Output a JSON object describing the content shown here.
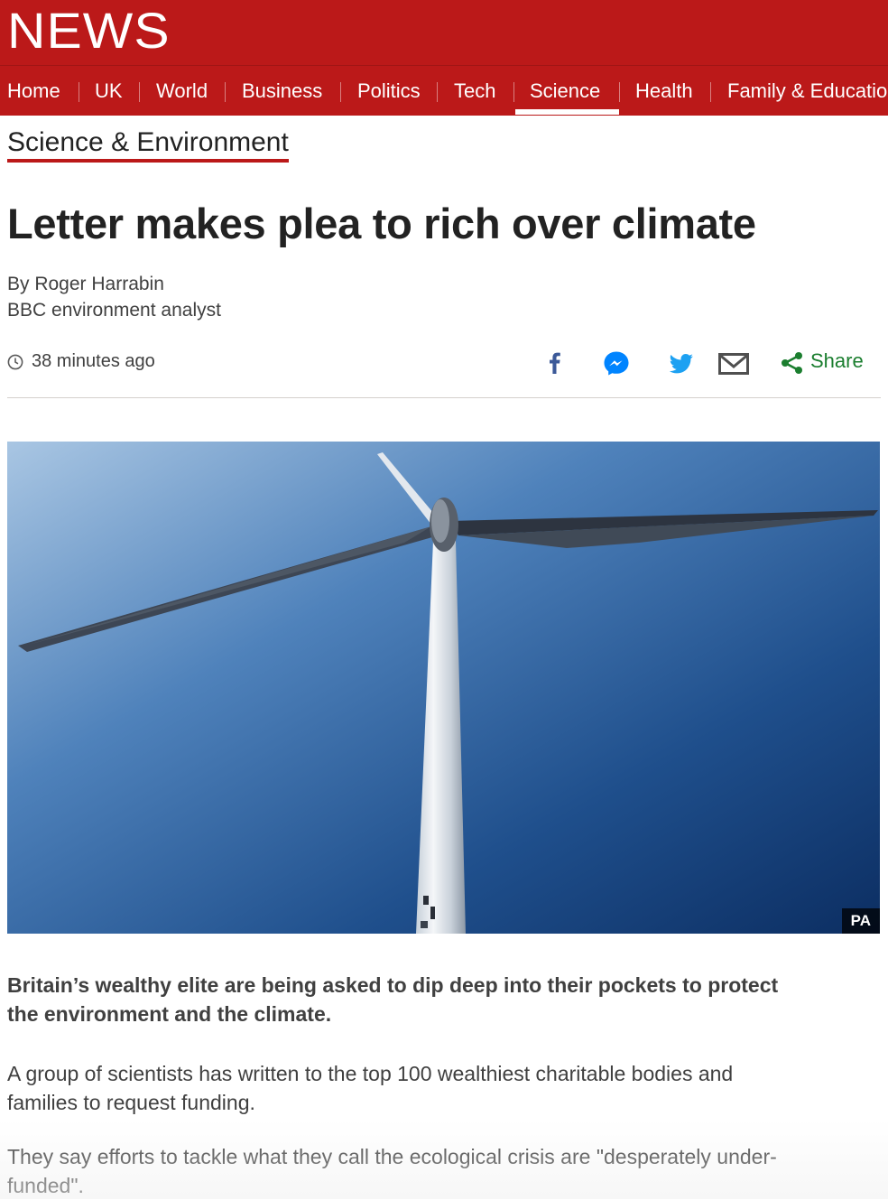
{
  "header": {
    "logo": "NEWS"
  },
  "nav": {
    "items": [
      {
        "label": "Home"
      },
      {
        "label": "UK"
      },
      {
        "label": "World"
      },
      {
        "label": "Business"
      },
      {
        "label": "Politics"
      },
      {
        "label": "Tech"
      },
      {
        "label": "Science",
        "active": true
      },
      {
        "label": "Health"
      },
      {
        "label": "Family & Education"
      }
    ]
  },
  "section": {
    "title": "Science & Environment"
  },
  "article": {
    "headline": "Letter makes plea to rich over climate",
    "byline": {
      "author": "By Roger Harrabin",
      "role": "BBC environment analyst"
    },
    "timestamp": "38 minutes ago",
    "image": {
      "credit": "PA"
    },
    "intro": "Britain’s wealthy elite are being asked to dip deep into their pockets to protect the environment and the climate.",
    "paragraphs": [
      "A group of scientists has written to the top 100 wealthiest charitable bodies and families to request funding.",
      "They say efforts to tackle what they call the ecological crisis are \"desperately under-funded\"."
    ]
  },
  "share": {
    "label": "Share",
    "icons": [
      "facebook-icon",
      "messenger-icon",
      "twitter-icon",
      "email-icon",
      "share-icon"
    ]
  },
  "colors": {
    "brand_red": "#bb1919",
    "share_green": "#1b7e2f",
    "facebook_blue": "#3b5998",
    "messenger_blue": "#0084ff",
    "twitter_blue": "#1da1f2"
  }
}
